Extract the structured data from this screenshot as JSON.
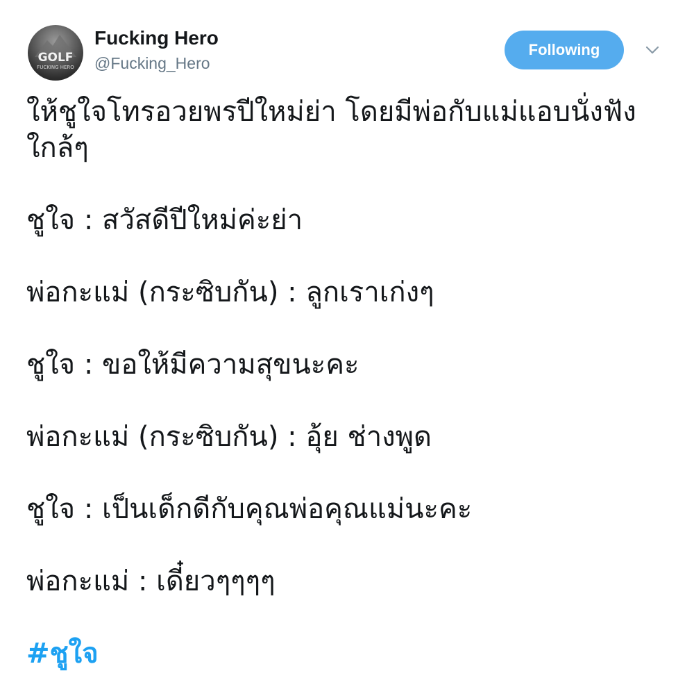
{
  "user": {
    "display_name": "Fucking Hero",
    "username": "@Fucking_Hero",
    "avatar_text_top": "GOLF",
    "avatar_text_bottom": "FUCKING HERO"
  },
  "actions": {
    "follow_label": "Following",
    "menu_icon": "chevron-down-icon"
  },
  "tweet": {
    "intro": "ให้ชูใจโทรอวยพรปีใหม่ย่า โดยมีพ่อกับแม่แอบนั่งฟังใกล้ๆ",
    "lines": [
      "ชูใจ : สวัสดีปีใหม่ค่ะย่า",
      "พ่อกะแม่ (กระซิบกัน) : ลูกเราเก่งๆ",
      "ชูใจ : ขอให้มีความสุขนะคะ",
      "พ่อกะแม่ (กระซิบกัน) : อุ้ย ช่างพูด",
      "ชูใจ : เป็นเด็กดีกับคุณพ่อคุณแม่นะคะ",
      "พ่อกะแม่ : เดี๋ยวๆๆๆๆ"
    ],
    "hashtag": "#ชูใจ"
  },
  "colors": {
    "follow_bg": "#55acee",
    "hashtag": "#1da1f2",
    "username": "#657786",
    "text": "#14171a"
  }
}
